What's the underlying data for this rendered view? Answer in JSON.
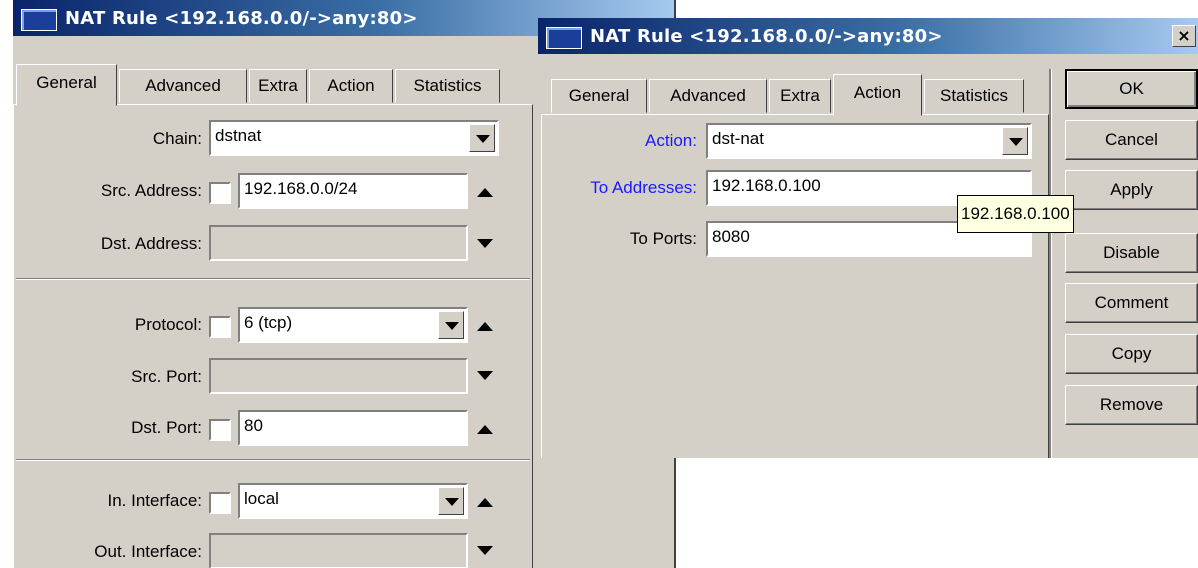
{
  "left_window": {
    "title": "NAT Rule <192.168.0.0/->any:80>",
    "tabs": [
      "General",
      "Advanced",
      "Extra",
      "Action",
      "Statistics"
    ],
    "active_tab": "General",
    "fields": {
      "chain": {
        "label": "Chain:",
        "value": "dstnat"
      },
      "src_address": {
        "label": "Src. Address:",
        "value": "192.168.0.0/24"
      },
      "dst_address": {
        "label": "Dst. Address:",
        "value": ""
      },
      "protocol": {
        "label": "Protocol:",
        "value": "6 (tcp)"
      },
      "src_port": {
        "label": "Src. Port:",
        "value": ""
      },
      "dst_port": {
        "label": "Dst. Port:",
        "value": "80"
      },
      "in_interface": {
        "label": "In. Interface:",
        "value": "local"
      },
      "out_interface": {
        "label": "Out. Interface:",
        "value": ""
      }
    }
  },
  "right_window": {
    "title": "NAT Rule <192.168.0.0/->any:80>",
    "close_label": "×",
    "tabs": [
      "General",
      "Advanced",
      "Extra",
      "Action",
      "Statistics"
    ],
    "active_tab": "Action",
    "fields": {
      "action": {
        "label": "Action:",
        "value": "dst-nat"
      },
      "to_addresses": {
        "label": "To Addresses:",
        "value": "192.168.0.100"
      },
      "to_ports": {
        "label": "To Ports:",
        "value": "8080"
      }
    },
    "tooltip": "192.168.0.100",
    "buttons": [
      "OK",
      "Cancel",
      "Apply",
      "Disable",
      "Comment",
      "Copy",
      "Remove"
    ]
  },
  "colors": {
    "title_gradient_start": "#0a246a",
    "title_gradient_end": "#a6caf0",
    "window_bg": "#d4d0c8",
    "highlight_label": "#1a1aff",
    "tooltip_bg": "#ffffe1"
  }
}
